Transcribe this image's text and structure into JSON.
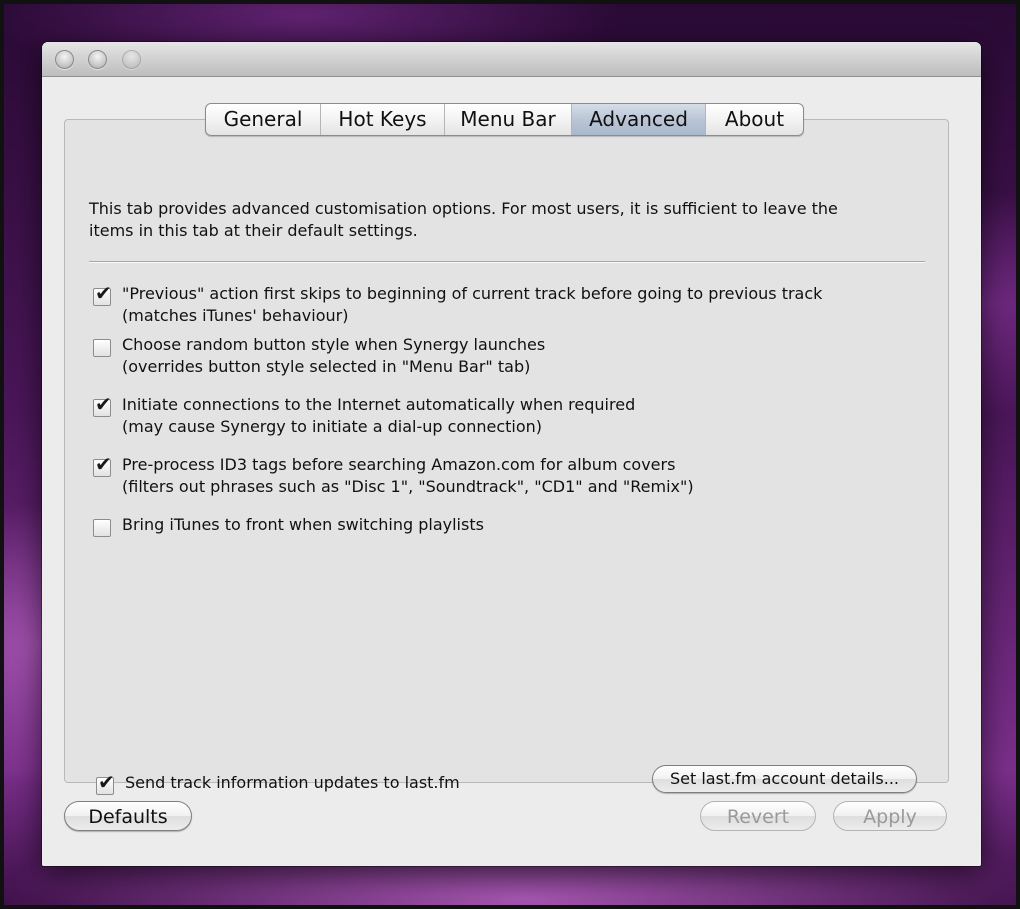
{
  "window": {
    "controls": [
      "close-button",
      "minimize-button",
      "zoom-button"
    ]
  },
  "tabs": [
    {
      "label": "General",
      "selected": false
    },
    {
      "label": "Hot Keys",
      "selected": false
    },
    {
      "label": "Menu Bar",
      "selected": false
    },
    {
      "label": "Advanced",
      "selected": true
    },
    {
      "label": "About",
      "selected": false
    }
  ],
  "advanced": {
    "intro_line1": "This tab provides advanced customisation options. For most users, it is sufficient to leave the",
    "intro_line2": "items in this tab at their default settings.",
    "options": [
      {
        "main": "\"Previous\" action first skips to beginning of current track before going to previous track",
        "sub": "(matches iTunes' behaviour)",
        "checked": true
      },
      {
        "main": "Choose random button style when Synergy launches",
        "sub": "(overrides button style selected in \"Menu Bar\" tab)",
        "checked": false
      },
      {
        "main": "Initiate connections to the Internet automatically when required",
        "sub": "(may cause Synergy to initiate a dial-up connection)",
        "checked": true
      },
      {
        "main": "Pre-process ID3 tags before searching Amazon.com for album covers",
        "sub": "(filters out phrases such as \"Disc 1\", \"Soundtrack\", \"CD1\" and \"Remix\")",
        "checked": true
      },
      {
        "main": "Bring iTunes to front when switching playlists",
        "sub": "",
        "checked": false
      }
    ],
    "lastfm_checkbox": {
      "label": "Send track information updates to last.fm",
      "checked": true
    },
    "lastfm_button": "Set last.fm account details..."
  },
  "footer": {
    "defaults_label": "Defaults",
    "revert_label": "Revert",
    "apply_label": "Apply",
    "revert_enabled": false,
    "apply_enabled": false
  },
  "check_glyph": "✔"
}
